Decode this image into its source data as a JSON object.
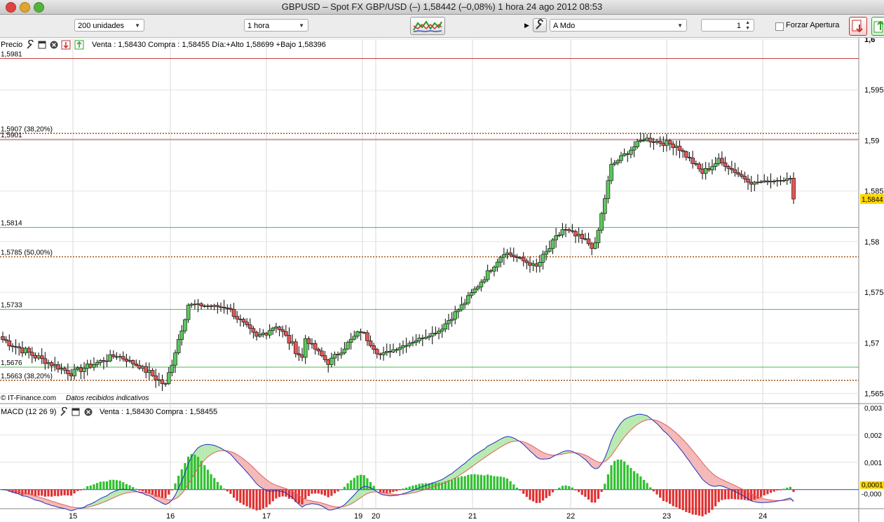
{
  "window": {
    "title": "GBPUSD – Spot FX GBP/USD (–)    1,58442 (–0,08%)    1 hora  24 ago 2012 08:53"
  },
  "toolbar": {
    "units_select": "200 unidades",
    "timeframe_select": "1 hora",
    "order_type_select": "A Mdo",
    "quantity_value": "1",
    "force_open_label": "Forzar Apertura"
  },
  "price_panel": {
    "label": "Precio",
    "info": "Venta : 1,58430 Compra : 1,58455  Día:+Alto 1,58699 +Bajo 1,58396",
    "copyright": "© IT-Finance.com",
    "status": "Datos recibidos indicativos",
    "current_price_badge": "1,5844",
    "y_ticks": [
      "1,6",
      "1,595",
      "1,59",
      "1,585",
      "1,58",
      "1,575",
      "1,57",
      "1,565"
    ],
    "hlines": [
      {
        "label": "1,5981",
        "value": 1.5981,
        "color": "#c44040",
        "style": "solid"
      },
      {
        "label": "1,5907 (38,20%)",
        "value": 1.5907,
        "color": "#a05010",
        "style": "dotted"
      },
      {
        "label": "1,5901",
        "value": 1.5901,
        "color": "#c44040",
        "style": "solid"
      },
      {
        "label": "1,5814",
        "value": 1.5814,
        "color": "#4cb84c",
        "style": "solid"
      },
      {
        "label": "1,5785 (50,00%)",
        "value": 1.5785,
        "color": "#a05010",
        "style": "dotted"
      },
      {
        "label": "1,5733",
        "value": 1.5733,
        "color": "#4cb84c",
        "style": "solid"
      },
      {
        "label": "1,5676",
        "value": 1.5676,
        "color": "#4cb84c",
        "style": "solid"
      },
      {
        "label": "1,5663 (38,20%)",
        "value": 1.5663,
        "color": "#a05010",
        "style": "dotted"
      }
    ]
  },
  "macd_panel": {
    "label": "MACD (12 26 9)",
    "info": "Venta : 1,58430 Compra : 1,58455",
    "y_ticks": [
      "0,003",
      "0,002",
      "0,001"
    ],
    "current_badge_pos": "0,0001",
    "current_badge_neg": "-0,000"
  },
  "x_axis": {
    "ticks": [
      "15",
      "16",
      "17",
      "19",
      "20",
      "21",
      "22",
      "23",
      "24"
    ]
  },
  "colors": {
    "up_candle": "#5cc85c",
    "down_candle": "#e05858",
    "macd_line": "#2030c0",
    "signal_line": "#e06060",
    "histogram_up": "#30c030",
    "histogram_down": "#e03030",
    "badge": "#ffd700"
  },
  "chart_data": [
    {
      "type": "candlestick",
      "title": "Precio",
      "ylim": [
        1.564,
        1.6
      ],
      "x_ticks": [
        "15",
        "16",
        "17",
        "19",
        "20",
        "21",
        "22",
        "23",
        "24"
      ],
      "segments": [
        {
          "from": 1.5705,
          "to": 1.5685,
          "n": 12,
          "amp": 0.0008
        },
        {
          "from": 1.5685,
          "to": 1.567,
          "n": 10,
          "amp": 0.0006
        },
        {
          "from": 1.567,
          "to": 1.5688,
          "n": 14,
          "amp": 0.0006
        },
        {
          "from": 1.5688,
          "to": 1.5675,
          "n": 8,
          "amp": 0.0004
        },
        {
          "from": 1.5675,
          "to": 1.5658,
          "n": 7,
          "amp": 0.0007
        },
        {
          "from": 1.5658,
          "to": 1.5738,
          "n": 7,
          "amp": 0.0008
        },
        {
          "from": 1.5738,
          "to": 1.5735,
          "n": 12,
          "amp": 0.0003
        },
        {
          "from": 1.5735,
          "to": 1.5705,
          "n": 9,
          "amp": 0.0006
        },
        {
          "from": 1.5705,
          "to": 1.5718,
          "n": 6,
          "amp": 0.0008
        },
        {
          "from": 1.5718,
          "to": 1.5685,
          "n": 8,
          "amp": 0.0008
        },
        {
          "from": 1.5708,
          "to": 1.568,
          "n": 8,
          "amp": 0.0004
        },
        {
          "from": 1.568,
          "to": 1.5712,
          "n": 10,
          "amp": 0.0006
        },
        {
          "from": 1.5712,
          "to": 1.5688,
          "n": 6,
          "amp": 0.0006
        },
        {
          "from": 1.5688,
          "to": 1.5712,
          "n": 18,
          "amp": 0.0003
        },
        {
          "from": 1.5712,
          "to": 1.574,
          "n": 8,
          "amp": 0.0005
        },
        {
          "from": 1.574,
          "to": 1.579,
          "n": 12,
          "amp": 0.0006
        },
        {
          "from": 1.579,
          "to": 1.5775,
          "n": 10,
          "amp": 0.0004
        },
        {
          "from": 1.5775,
          "to": 1.5812,
          "n": 8,
          "amp": 0.0008
        },
        {
          "from": 1.5812,
          "to": 1.5795,
          "n": 10,
          "amp": 0.0008
        },
        {
          "from": 1.5795,
          "to": 1.5875,
          "n": 5,
          "amp": 0.0005
        },
        {
          "from": 1.5875,
          "to": 1.5902,
          "n": 10,
          "amp": 0.0005
        },
        {
          "from": 1.5902,
          "to": 1.5895,
          "n": 10,
          "amp": 0.0006
        },
        {
          "from": 1.5895,
          "to": 1.5868,
          "n": 8,
          "amp": 0.0005
        },
        {
          "from": 1.5868,
          "to": 1.588,
          "n": 5,
          "amp": 0.0006
        },
        {
          "from": 1.588,
          "to": 1.5858,
          "n": 10,
          "amp": 0.0003
        },
        {
          "from": 1.5858,
          "to": 1.5862,
          "n": 12,
          "amp": 0.0002
        },
        {
          "from": 1.5862,
          "to": 1.5844,
          "n": 1,
          "amp": 0.0004
        }
      ]
    },
    {
      "type": "macd",
      "title": "MACD (12 26 9)",
      "ylim": [
        -0.0007,
        0.0031
      ],
      "series": [
        {
          "name": "MACD"
        },
        {
          "name": "Signal"
        }
      ],
      "x_ticks": [
        "15",
        "16",
        "17",
        "19",
        "20",
        "21",
        "22",
        "23",
        "24"
      ]
    }
  ]
}
